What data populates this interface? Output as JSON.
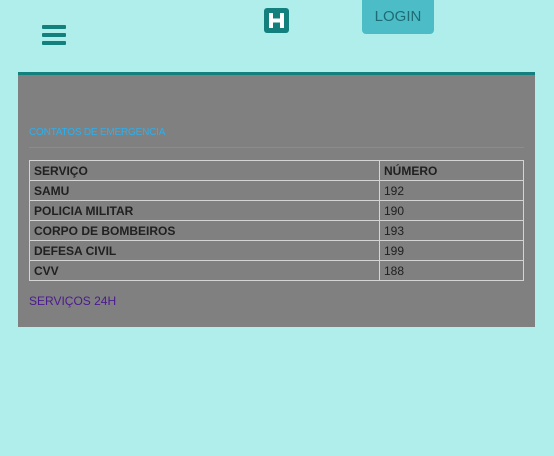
{
  "header": {
    "menu_icon": "hamburger-menu-icon",
    "logo_icon": "hospital-h-icon",
    "logo_letter": "H",
    "login_label": "LOGIN"
  },
  "colors": {
    "page_background": "#b0eeec",
    "accent": "#14807e",
    "panel_background": "#808080",
    "login_button": "#4cbcc7",
    "title_text": "#2ab0ef",
    "link_text": "#4b1a8e"
  },
  "main": {
    "section_title": "CONTATOS DE EMERGENCIA",
    "table": {
      "headers": [
        "SERVIÇO",
        "NÚMERO"
      ],
      "rows": [
        [
          "SAMU",
          "192"
        ],
        [
          "POLICIA MILITAR",
          "190"
        ],
        [
          "CORPO DE BOMBEIROS",
          "193"
        ],
        [
          "DEFESA CIVIL",
          "199"
        ],
        [
          "CVV",
          "188"
        ]
      ]
    },
    "services_link": "SERVIÇOS 24H"
  }
}
